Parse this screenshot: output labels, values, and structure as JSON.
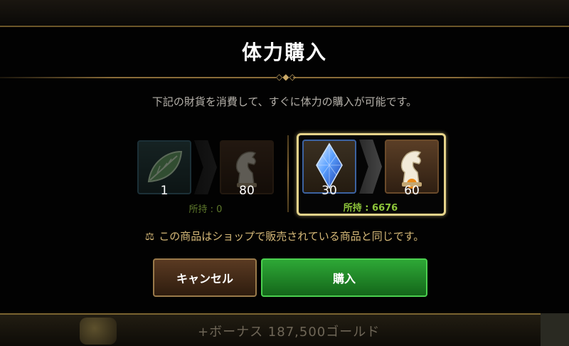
{
  "dialog": {
    "title": "体力購入",
    "description": "下記の財貨を消費して、すぐに体力の購入が可能です。",
    "notice": "この商品はショップで販売されている商品と同じです。",
    "buttons": {
      "cancel_label": "キャンセル",
      "buy_label": "購入"
    }
  },
  "options": [
    {
      "cost_icon": "leaf-icon",
      "cost_qty": "1",
      "reward_icon": "horse-icon",
      "reward_qty": "80",
      "owned": "所持 : 0",
      "selected": false
    },
    {
      "cost_icon": "crystal-icon",
      "cost_qty": "30",
      "reward_icon": "horse-icon",
      "reward_qty": "60",
      "owned": "所持 : 6676",
      "selected": true
    }
  ],
  "background": {
    "banner_text": "+ボーナス 187,500ゴールド"
  },
  "colors": {
    "accent_gold": "#e6d38a",
    "buy_green": "#2ea836",
    "owned_green": "#8ec63a"
  }
}
